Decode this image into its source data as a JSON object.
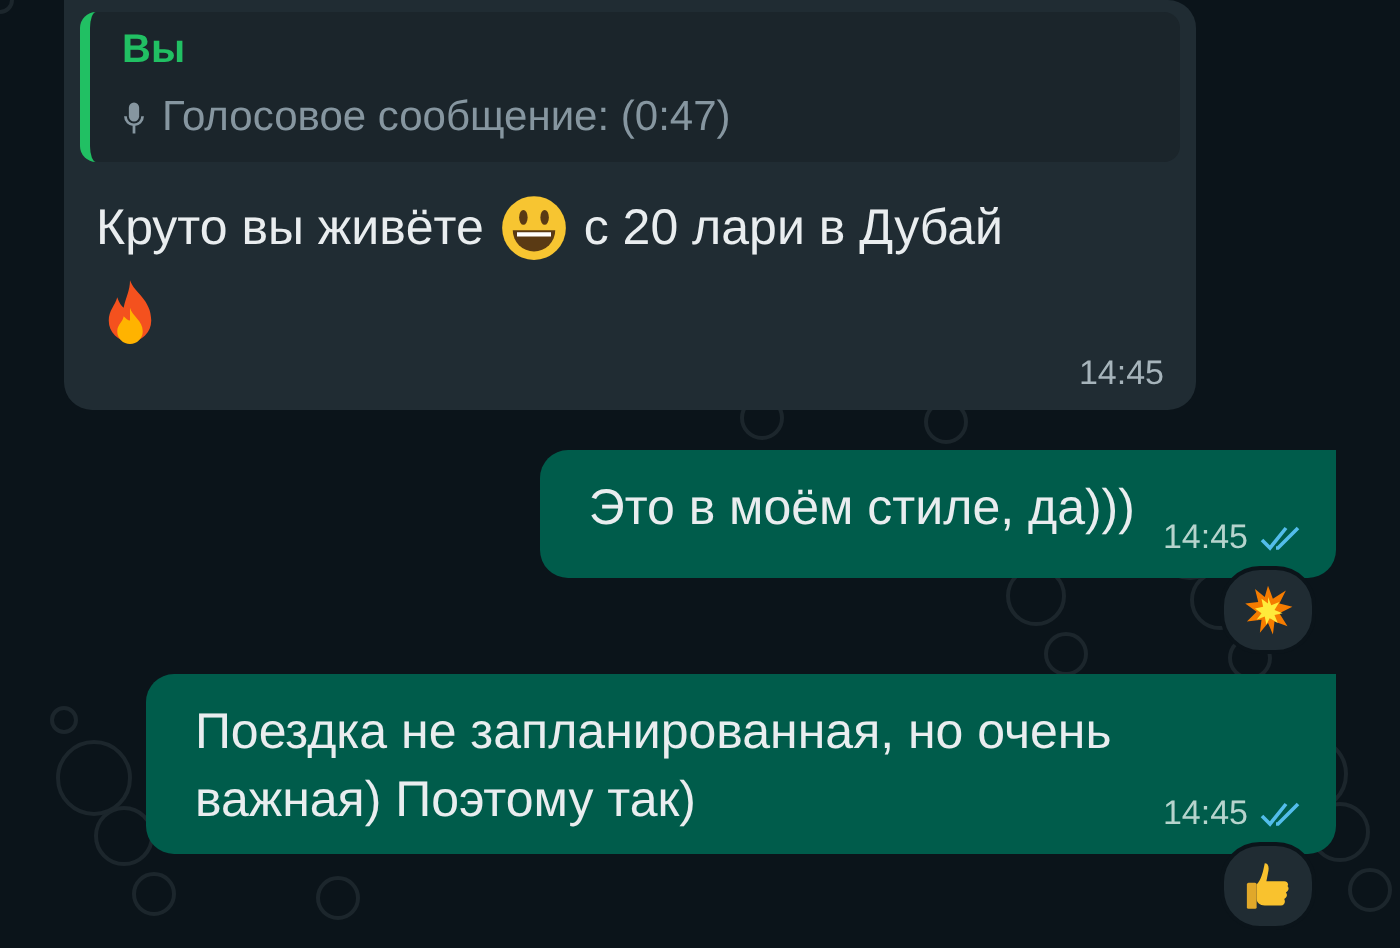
{
  "messages": [
    {
      "kind": "in",
      "quote": {
        "author": "Вы",
        "text": "Голосовое сообщение: (0:47)"
      },
      "lines": [
        [
          {
            "kind": "text",
            "text": "Круто вы живёте"
          },
          {
            "kind": "smiley"
          },
          {
            "kind": "text",
            "text": "с 20 лари в Дубай"
          }
        ],
        [
          {
            "kind": "fire"
          }
        ]
      ],
      "time": "14:45"
    },
    {
      "kind": "out",
      "lines": [
        [
          {
            "kind": "text",
            "text": "Это в моём стиле, да)))"
          }
        ]
      ],
      "time": "14:45",
      "read": true,
      "reaction": {
        "kind": "explosion"
      }
    },
    {
      "kind": "out",
      "lines": [
        [
          {
            "kind": "text",
            "text": "Поездка не запланированная, но очень важная) Поэтому так)"
          }
        ]
      ],
      "time": "14:45",
      "read": true,
      "reaction": {
        "kind": "thumbs-up"
      }
    }
  ]
}
